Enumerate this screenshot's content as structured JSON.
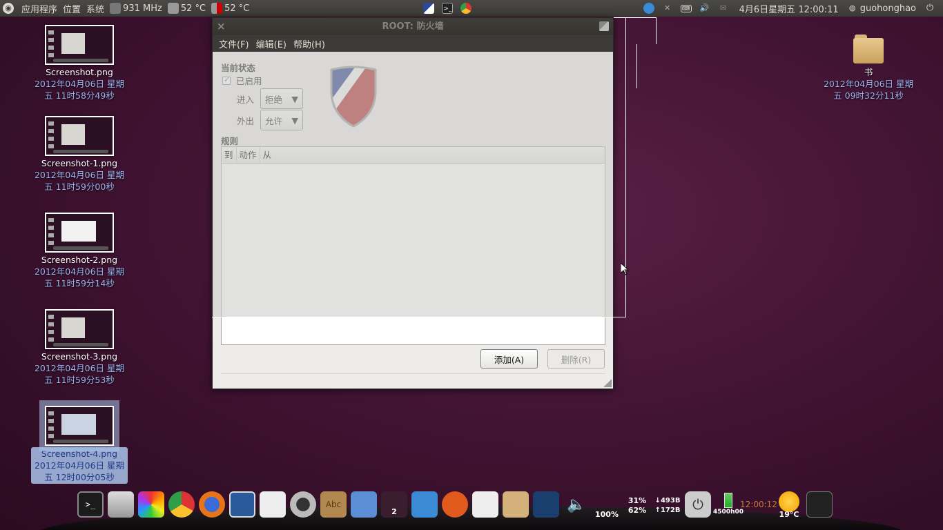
{
  "top_panel": {
    "applications": "应用程序",
    "places": "位置",
    "system": "系统",
    "cpu_freq": "931 MHz",
    "temp1": "52 °C",
    "temp2": "52 °C",
    "datetime": "4月6日星期五 12:00:11",
    "username": "guohonghao"
  },
  "desktop": {
    "icons": [
      {
        "name": "Screenshot.png",
        "date1": "2012年04月06日 星期",
        "date2": "五 11时58分49秒"
      },
      {
        "name": "Screenshot-1.png",
        "date1": "2012年04月06日 星期",
        "date2": "五 11时59分00秒"
      },
      {
        "name": "Screenshot-2.png",
        "date1": "2012年04月06日 星期",
        "date2": "五 11时59分14秒"
      },
      {
        "name": "Screenshot-3.png",
        "date1": "2012年04月06日 星期",
        "date2": "五 11时59分53秒"
      },
      {
        "name": "Screenshot-4.png",
        "date1": "2012年04月06日 星期",
        "date2": "五 12时00分05秒"
      }
    ],
    "folder": {
      "name": "书",
      "date1": "2012年04月06日 星期",
      "date2": "五 09时32分11秒"
    }
  },
  "firewall": {
    "title": "ROOT: 防火墙",
    "menu": {
      "file": "文件(F)",
      "edit": "编辑(E)",
      "help": "帮助(H)"
    },
    "status_heading": "当前状态",
    "enabled_label": "已启用",
    "incoming_label": "进入",
    "incoming_value": "拒绝",
    "outgoing_label": "外出",
    "outgoing_value": "允许",
    "rules_heading": "规则",
    "columns": [
      "到",
      "动作",
      "从"
    ],
    "add_button": "添加(A)",
    "remove_button": "删除(R)"
  },
  "dock": {
    "badge_count": "2",
    "volume_pct": "100%",
    "cpu_pct": "31%",
    "mem_pct": "62%",
    "net_down": "↓493B",
    "net_up": "↑172B",
    "battery": "4500h00",
    "clock": "12:00:12",
    "weather_temp": "19°C"
  },
  "colors": {
    "desktop_bg": "#3e1230",
    "panel_bg": "#3c3b37",
    "date_text": "#9bb4f0"
  }
}
